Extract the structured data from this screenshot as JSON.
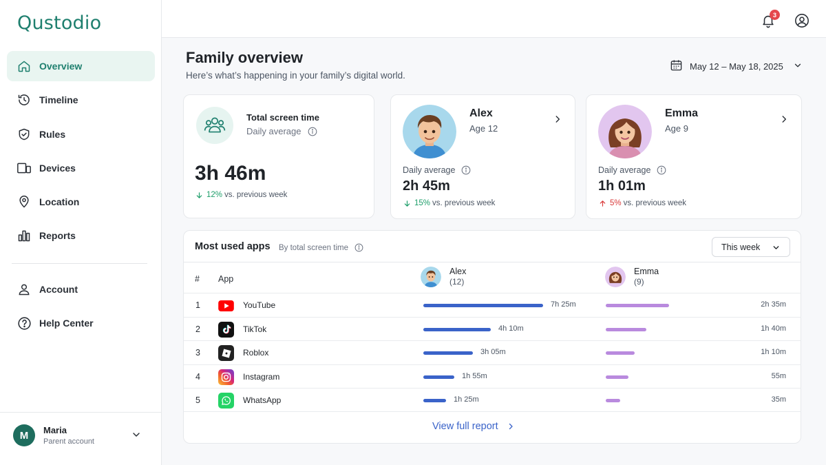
{
  "app": {
    "logo": "Qustodio"
  },
  "sidebar": {
    "items": [
      {
        "label": "Overview",
        "icon": "home-icon",
        "active": true
      },
      {
        "label": "Timeline",
        "icon": "clock-history-icon"
      },
      {
        "label": "Rules",
        "icon": "shield-check-icon"
      },
      {
        "label": "Devices",
        "icon": "devices-icon"
      },
      {
        "label": "Location",
        "icon": "location-pin-icon"
      },
      {
        "label": "Reports",
        "icon": "bar-chart-icon"
      }
    ],
    "secondary": [
      {
        "label": "Account",
        "icon": "user-icon"
      },
      {
        "label": "Help Center",
        "icon": "help-circle-icon"
      }
    ],
    "user": {
      "initial": "M",
      "name": "Maria",
      "role": "Parent account"
    }
  },
  "topbar": {
    "notifications_count": "3"
  },
  "header": {
    "title": "Family overview",
    "subtitle": "Here’s what’s happening in your family’s digital world.",
    "date_range": "May 12 – May 18, 2025"
  },
  "summary": {
    "label": "Total screen time",
    "sublabel": "Daily average",
    "time": "3h 46m",
    "change": "12%",
    "change_direction": "down",
    "change_suffix": "vs. previous week"
  },
  "kids": [
    {
      "name": "Alex",
      "age": "Age 12",
      "daily_label": "Daily average",
      "time": "2h 45m",
      "change": "15%",
      "change_direction": "down",
      "change_suffix": "vs. previous week"
    },
    {
      "name": "Emma",
      "age": "Age 9",
      "daily_label": "Daily average",
      "time": "1h 01m",
      "change": "5%",
      "change_direction": "up",
      "change_suffix": "vs. previous week"
    }
  ],
  "apps_table": {
    "title": "Most used apps",
    "subtitle": "By total screen time",
    "period": "This week",
    "col_num": "#",
    "col_app": "App",
    "col_kid1_name": "Alex",
    "col_kid1_age": "(12)",
    "col_kid2_name": "Emma",
    "col_kid2_age": "(9)",
    "rows": [
      {
        "rank": "1",
        "app": "YouTube",
        "icon": "youtube-icon",
        "alex": "7h 25m",
        "alex_minutes": 445,
        "emma": "2h 35m",
        "emma_minutes": 155
      },
      {
        "rank": "2",
        "app": "TikTok",
        "icon": "tiktok-icon",
        "alex": "4h 10m",
        "alex_minutes": 250,
        "emma": "1h 40m",
        "emma_minutes": 100
      },
      {
        "rank": "3",
        "app": "Roblox",
        "icon": "roblox-icon",
        "alex": "3h 05m",
        "alex_minutes": 185,
        "emma": "1h 10m",
        "emma_minutes": 70
      },
      {
        "rank": "4",
        "app": "Instagram",
        "icon": "instagram-icon",
        "alex": "1h 55m",
        "alex_minutes": 115,
        "emma": "55m",
        "emma_minutes": 55
      },
      {
        "rank": "5",
        "app": "WhatsApp",
        "icon": "whatsapp-icon",
        "alex": "1h 25m",
        "alex_minutes": 85,
        "emma": "35m",
        "emma_minutes": 35
      }
    ],
    "footer_link": "View full report"
  },
  "colors": {
    "brand": "#1e7f6e",
    "alex_bar": "#3a63c9",
    "emma_bar": "#b98ade",
    "trend_down": "#1e9e6a",
    "trend_up": "#d93a3a",
    "link": "#3a63c9"
  }
}
